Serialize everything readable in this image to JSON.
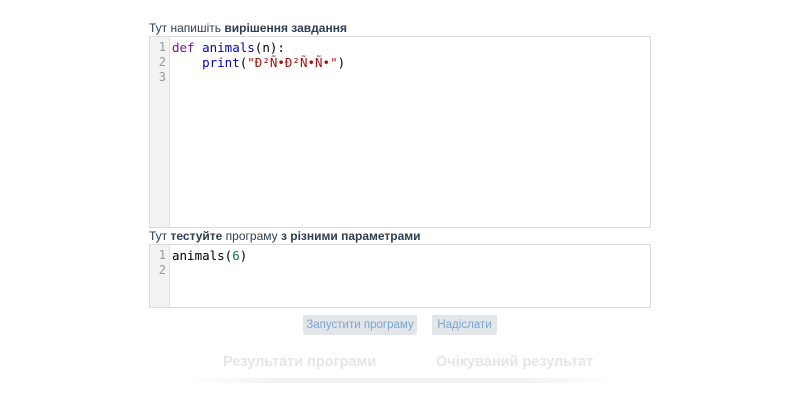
{
  "solution_caption": {
    "prefix": "Тут напишіть ",
    "bold": "вирішення завдання"
  },
  "solution_editor": {
    "line_numbers": [
      "1",
      "2",
      "3"
    ],
    "line1": {
      "kw": "def",
      "sp": " ",
      "fn": "animals",
      "rest": "(n):"
    },
    "line2": {
      "indent": "    ",
      "fn": "print",
      "open": "(",
      "str": "\"Ð²Ñ•Ð²Ñ•Ñ•\"",
      "close": ")"
    },
    "line3": ""
  },
  "test_caption": {
    "prefix": "Тут ",
    "bold1": "тестуйте",
    "mid": " програму ",
    "bold2": "з різними параметрами"
  },
  "test_editor": {
    "line_numbers": [
      "1",
      "2"
    ],
    "line1": {
      "fn": "animals(",
      "num": "6",
      "close": ")"
    },
    "line2": ""
  },
  "buttons": {
    "run": "Запустити програму",
    "send": "Надіслати"
  },
  "results": {
    "program": "Результати програми",
    "expected": "Очікуваний результат"
  }
}
